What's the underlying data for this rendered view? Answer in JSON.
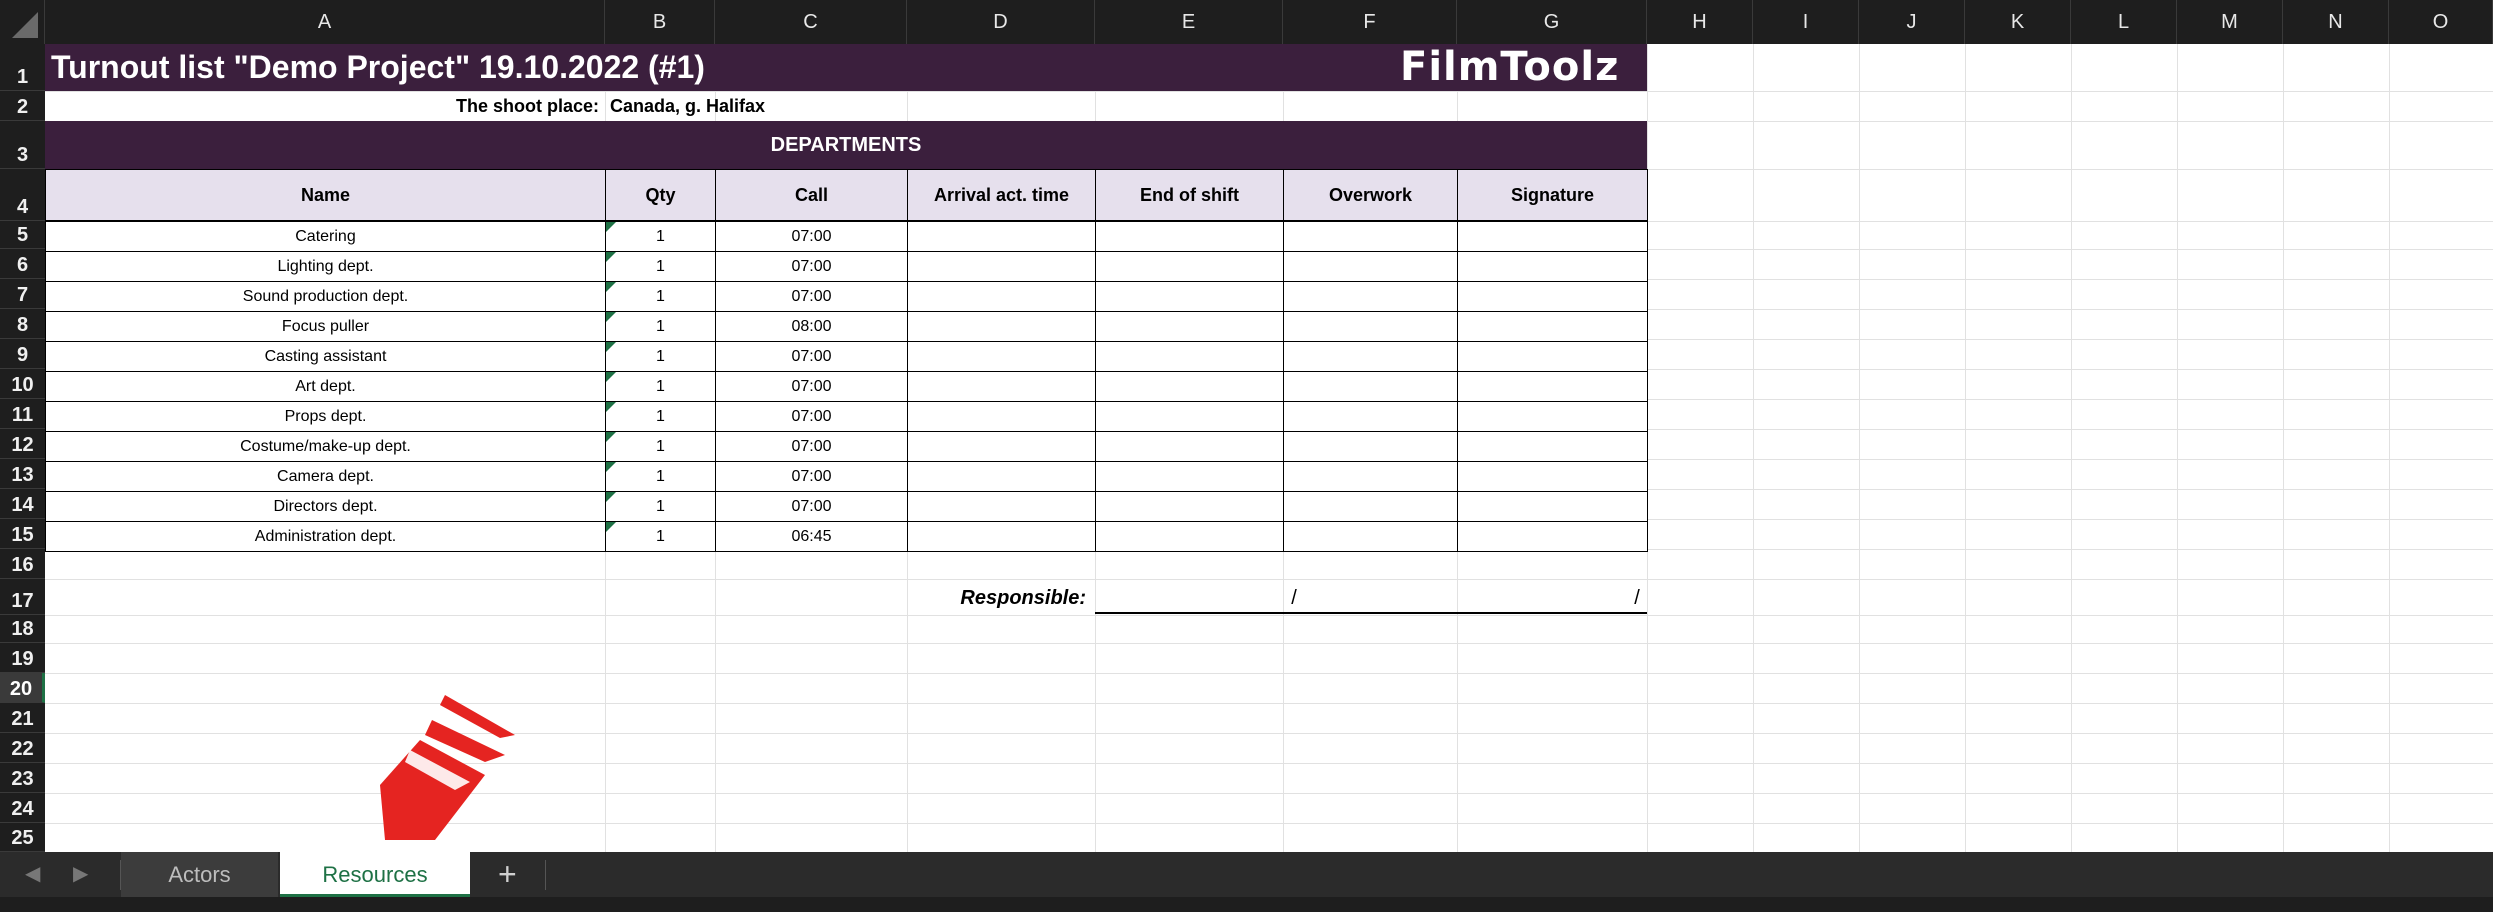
{
  "columns": [
    "A",
    "B",
    "C",
    "D",
    "E",
    "F",
    "G",
    "H",
    "I",
    "J",
    "K",
    "L",
    "M",
    "N",
    "O"
  ],
  "rows": [
    "1",
    "2",
    "3",
    "4",
    "5",
    "6",
    "7",
    "8",
    "9",
    "10",
    "11",
    "12",
    "13",
    "14",
    "15",
    "16",
    "17",
    "18",
    "19",
    "20",
    "21",
    "22",
    "23",
    "24",
    "25"
  ],
  "selected_row": "20",
  "sheet": {
    "title": "Turnout list \"Demo Project\" 19.10.2022 (#1)",
    "logo_text": "FilmToolz",
    "shoot_place_label": "The shoot place:",
    "shoot_place_value": "Canada, g. Halifax",
    "section_title": "DEPARTMENTS",
    "headers": [
      "Name",
      "Qty",
      "Call",
      "Arrival act. time",
      "End of shift",
      "Overwork",
      "Signature"
    ],
    "table_rows": [
      {
        "name": "Catering",
        "qty": "1",
        "call": "07:00"
      },
      {
        "name": "Lighting dept.",
        "qty": "1",
        "call": "07:00"
      },
      {
        "name": "Sound production dept.",
        "qty": "1",
        "call": "07:00"
      },
      {
        "name": "Focus puller",
        "qty": "1",
        "call": "08:00"
      },
      {
        "name": "Casting assistant",
        "qty": "1",
        "call": "07:00"
      },
      {
        "name": "Art dept.",
        "qty": "1",
        "call": "07:00"
      },
      {
        "name": "Props dept.",
        "qty": "1",
        "call": "07:00"
      },
      {
        "name": "Costume/make-up dept.",
        "qty": "1",
        "call": "07:00"
      },
      {
        "name": "Camera dept.",
        "qty": "1",
        "call": "07:00"
      },
      {
        "name": "Directors dept.",
        "qty": "1",
        "call": "07:00"
      },
      {
        "name": "Administration dept.",
        "qty": "1",
        "call": "06:45"
      }
    ],
    "responsible_label": "Responsible:",
    "slash": "/"
  },
  "tabs": {
    "items": [
      "Actors",
      "Resources"
    ],
    "active": "Resources",
    "add_label": "+",
    "prev_arrow": "◀",
    "next_arrow": "▶"
  },
  "colors": {
    "header_bg": "#3b1f3d",
    "table_header_bg": "#e6e0ed",
    "accent_green": "#1e7145",
    "logo_red": "#e52421"
  },
  "icons": {
    "logo_mark": "filmtoolz-chevron-icon"
  }
}
